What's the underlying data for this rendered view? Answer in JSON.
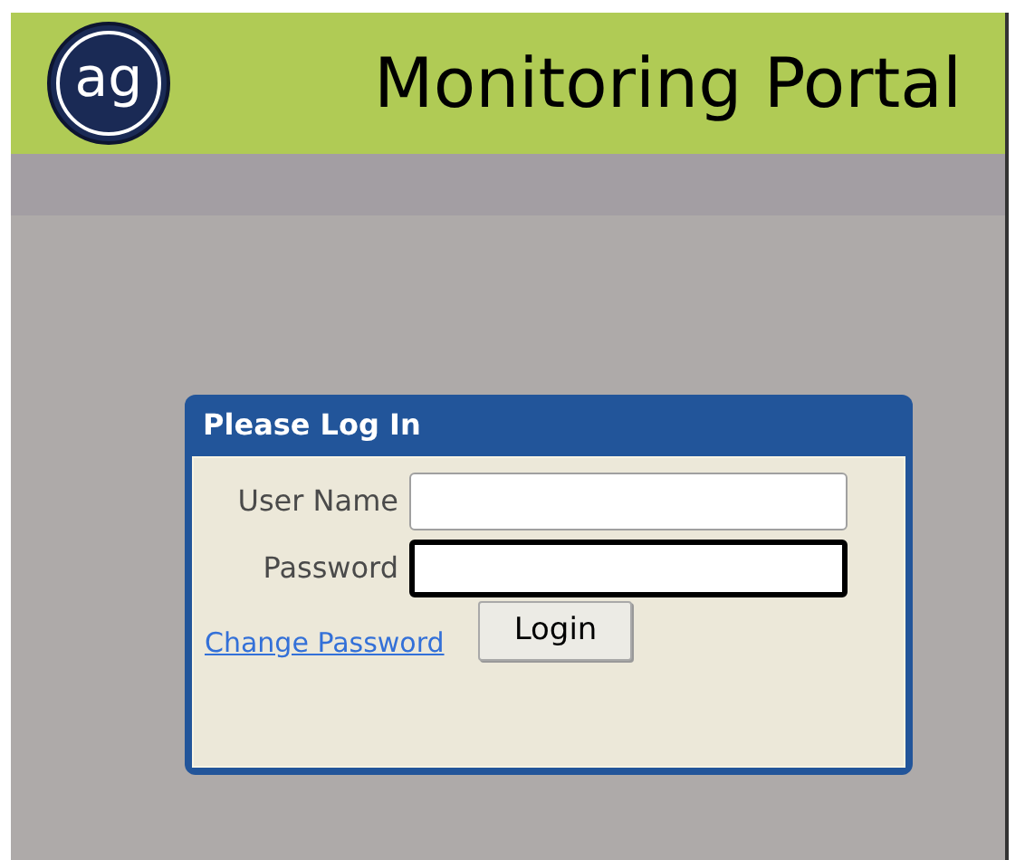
{
  "header": {
    "logo": "ag",
    "title": "Monitoring Portal"
  },
  "login": {
    "title": "Please Log In",
    "fields": [
      {
        "label": "User Name",
        "focused": false
      },
      {
        "label": "Password",
        "focused": true
      }
    ],
    "link": "Change Password",
    "button": "Login"
  }
}
